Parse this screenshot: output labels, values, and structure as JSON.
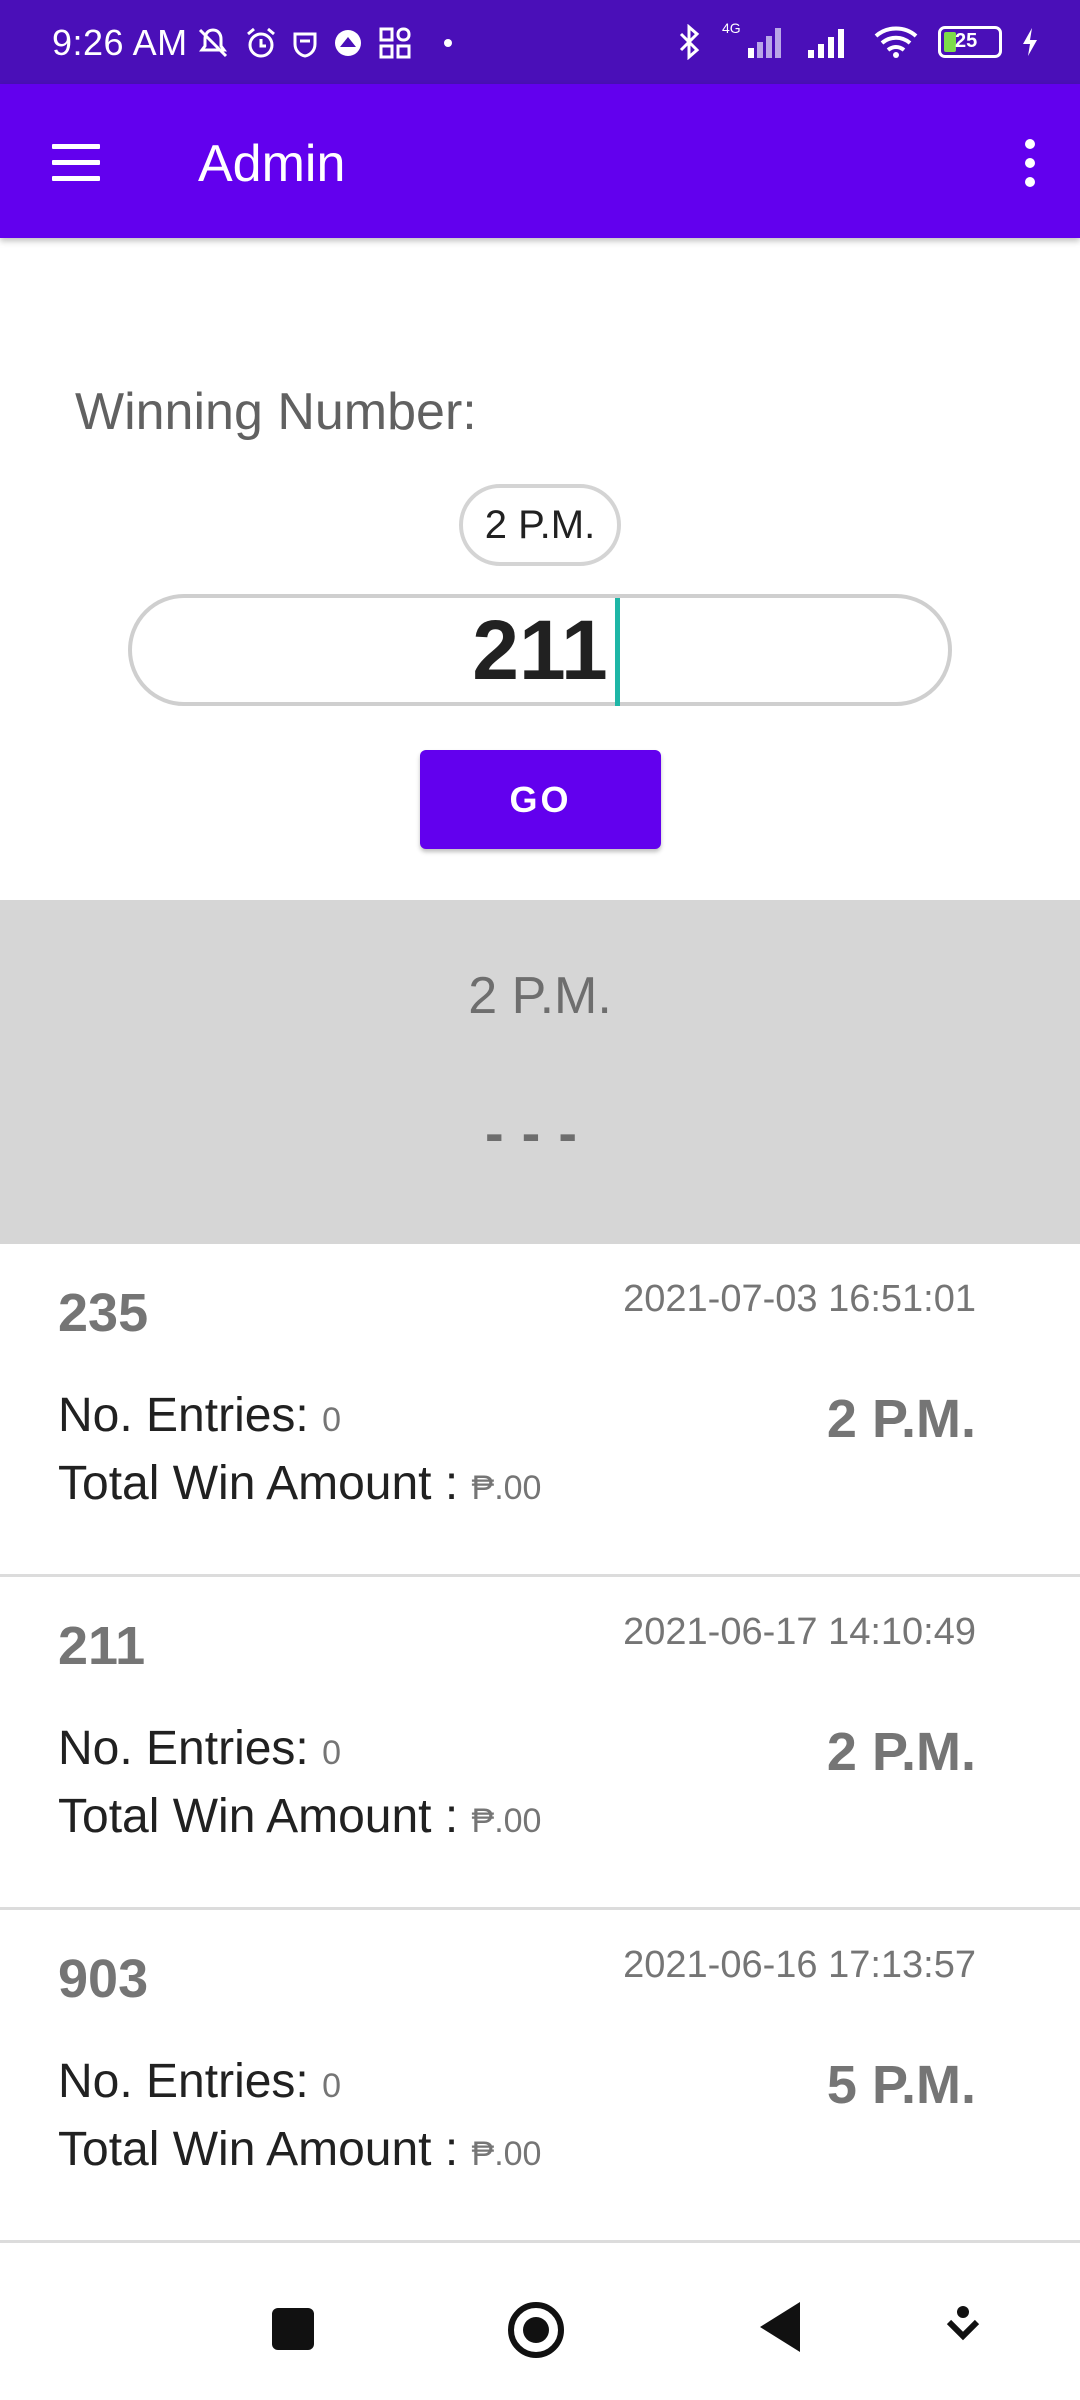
{
  "status_bar": {
    "time": "9:26 AM",
    "network_label": "4G",
    "battery": "25",
    "icons": [
      "mute-icon",
      "alarm-icon",
      "shield-icon",
      "app-icon",
      "grid-icon",
      "bluetooth-icon",
      "signal-icon",
      "wifi-icon",
      "battery-icon",
      "charging-icon"
    ]
  },
  "app_bar": {
    "title": "Admin",
    "background": "#6200ee"
  },
  "form": {
    "label": "Winning Number:",
    "time_chip": "2 P.M.",
    "input_value": "211",
    "go_label": "GO"
  },
  "result": {
    "time": "2 P.M.",
    "number": "---"
  },
  "list": {
    "entries_label": "No. Entries: ",
    "amount_label": "Total Win Amount : ",
    "items": [
      {
        "number": "235",
        "date": "2021-07-03 16:51:01",
        "entries": "0",
        "amount": "₱.00",
        "slot": "2 P.M."
      },
      {
        "number": "211",
        "date": "2021-06-17 14:10:49",
        "entries": "0",
        "amount": "₱.00",
        "slot": "2 P.M."
      },
      {
        "number": "903",
        "date": "2021-06-16 17:13:57",
        "entries": "0",
        "amount": "₱.00",
        "slot": "5 P.M."
      }
    ]
  },
  "nav_bar": {
    "icons": [
      "recents-icon",
      "home-icon",
      "back-icon",
      "assist-icon"
    ]
  }
}
